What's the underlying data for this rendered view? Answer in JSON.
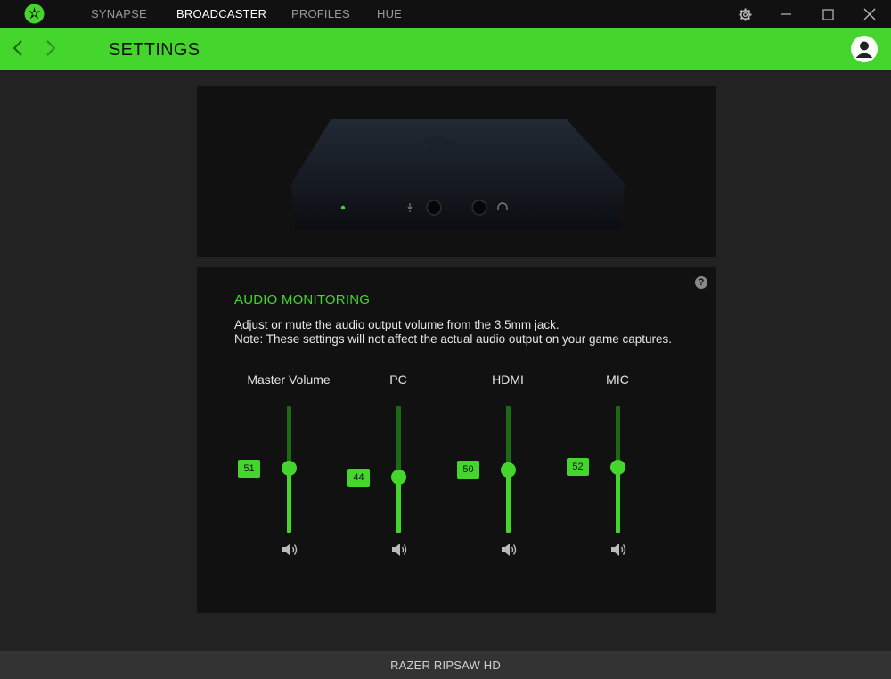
{
  "nav": {
    "tabs": [
      {
        "label": "SYNAPSE",
        "active": false
      },
      {
        "label": "BROADCASTER",
        "active": true
      },
      {
        "label": "PROFILES",
        "active": false
      },
      {
        "label": "HUE",
        "active": false
      }
    ],
    "icons": [
      "razer-logo-icon",
      "settings-icon",
      "minimize-icon",
      "maximize-icon",
      "close-icon"
    ]
  },
  "header": {
    "title": "SETTINGS",
    "icons": [
      "back-arrow-icon",
      "forward-arrow-icon",
      "user-avatar-icon"
    ]
  },
  "audio": {
    "title": "AUDIO MONITORING",
    "description_line1": "Adjust or mute the audio output volume from the 3.5mm jack.",
    "description_line2": "Note: These settings will not affect the actual audio output on your game captures.",
    "help_label": "?",
    "sliders": [
      {
        "label": "Master Volume",
        "value": "51",
        "level": 0.51
      },
      {
        "label": "PC",
        "value": "44",
        "level": 0.44
      },
      {
        "label": "HDMI",
        "value": "50",
        "level": 0.5
      },
      {
        "label": "MIC",
        "value": "52",
        "level": 0.52
      }
    ]
  },
  "footer": {
    "device_name": "RAZER RIPSAW HD"
  },
  "colors": {
    "accent": "#44d62c",
    "background": "#222222",
    "panel": "#111111",
    "titlebar": "#111111",
    "footer": "#333333"
  }
}
